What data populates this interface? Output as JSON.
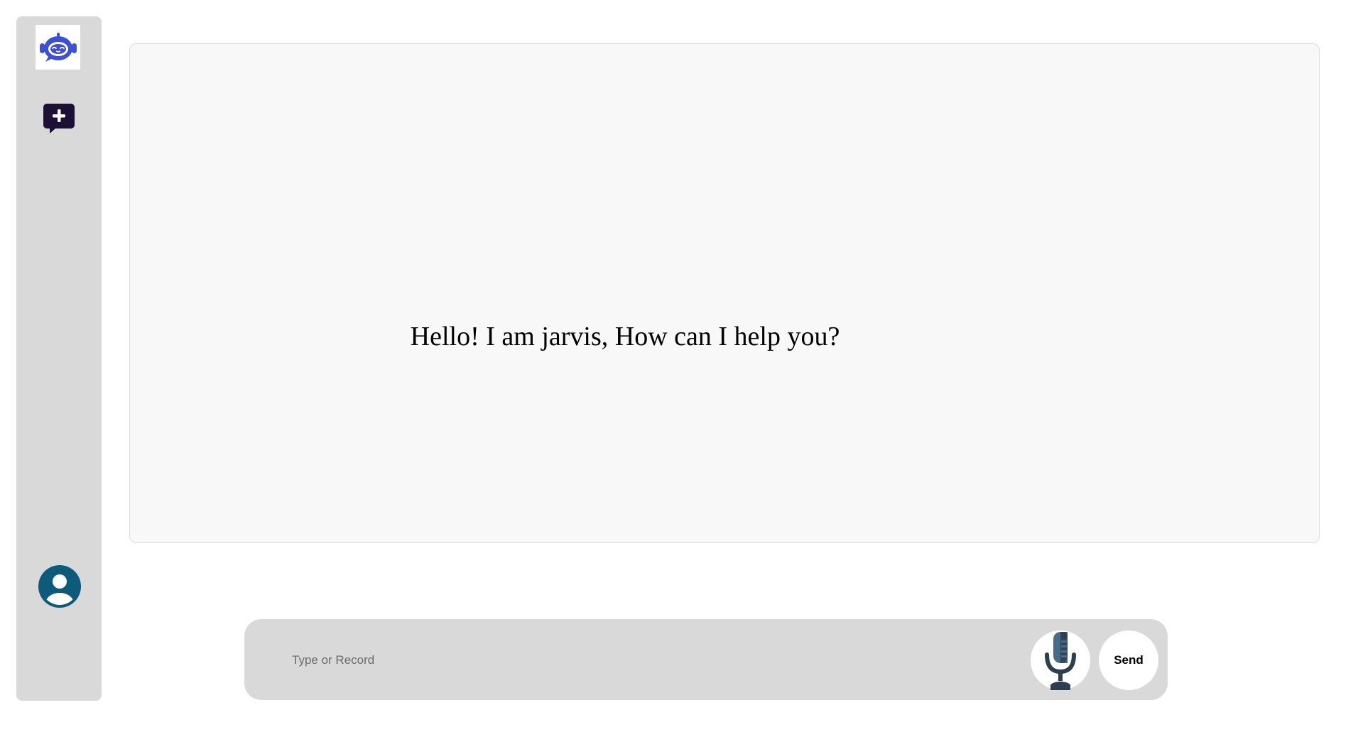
{
  "sidebar": {
    "logo_icon": "robot-logo-icon",
    "new_chat_icon": "new-chat-plus-icon",
    "profile_icon": "user-avatar-icon"
  },
  "chat": {
    "greeting": "Hello! I am jarvis, How can I help you?"
  },
  "composer": {
    "placeholder": "Type or Record",
    "value": "",
    "mic_icon": "microphone-icon",
    "send_label": "Send"
  },
  "colors": {
    "sidebar_bg": "#d9d9d9",
    "panel_bg": "#f8f8f8",
    "robot_blue": "#3d4fd6",
    "new_chat_dark": "#1c1036",
    "avatar_teal": "#0e5a7a",
    "mic_dark": "#2c3e50"
  }
}
